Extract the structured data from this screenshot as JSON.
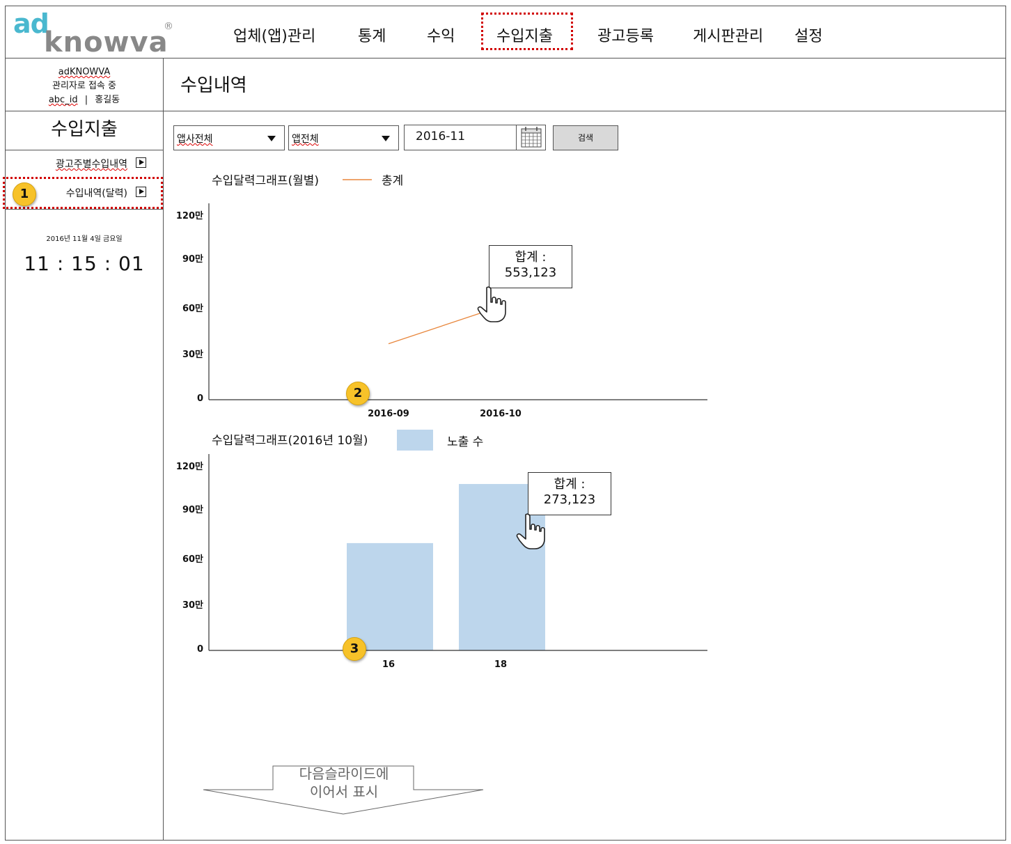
{
  "header": {
    "logo_top": "ad",
    "logo_bottom": "knowva",
    "logo_mark": "®",
    "nav": [
      {
        "label": "업체(앱)관리"
      },
      {
        "label": "통계"
      },
      {
        "label": "수익"
      },
      {
        "label": "수입지출",
        "active": true
      },
      {
        "label": "광고등록"
      },
      {
        "label": "게시판관리"
      },
      {
        "label": "설정"
      }
    ]
  },
  "sidebar": {
    "user": {
      "company": "adKNOWVA",
      "status": "관리자로 접속 중",
      "user_id": "abc_id",
      "separator": "|",
      "name": "홍길동"
    },
    "section_title": "수입지출",
    "menu": [
      {
        "label": "광고주별수입내역"
      },
      {
        "label": "수입내역(달력)",
        "selected": true
      }
    ],
    "date": "2016년 11월 4일 금요일",
    "clock": "11 : 15 : 01"
  },
  "main": {
    "title": "수입내역",
    "filters": {
      "company_select": "앱사전체",
      "app_select": "앱전체",
      "date_value": "2016-11",
      "search_label": "검색"
    }
  },
  "badges": [
    "1",
    "2",
    "3"
  ],
  "chart_data": [
    {
      "type": "line",
      "title": "수입달력그래프(월별)",
      "series": [
        {
          "name": "총계",
          "color": "#e8863c",
          "values": [
            360000,
            600000
          ]
        }
      ],
      "categories": [
        "2016-09",
        "2016-10"
      ],
      "yticks": [
        "0",
        "30만",
        "60만",
        "90만",
        "120만"
      ],
      "ylim": [
        0,
        1200000
      ],
      "tooltip": {
        "line1": "합계 :",
        "line2": "553,123"
      }
    },
    {
      "type": "bar",
      "title": "수입달력그래프(2016년 10월)",
      "series": [
        {
          "name": "노출 수",
          "color": "#bdd6ec",
          "values": [
            690000,
            1070000
          ]
        }
      ],
      "categories": [
        "16",
        "18"
      ],
      "yticks": [
        "0",
        "30만",
        "60만",
        "90만",
        "120만"
      ],
      "ylim": [
        0,
        1200000
      ],
      "tooltip": {
        "line1": "합계 :",
        "line2": "273,123"
      }
    }
  ],
  "next_slide": {
    "line1": "다음슬라이드에",
    "line2": "이어서 표시"
  }
}
